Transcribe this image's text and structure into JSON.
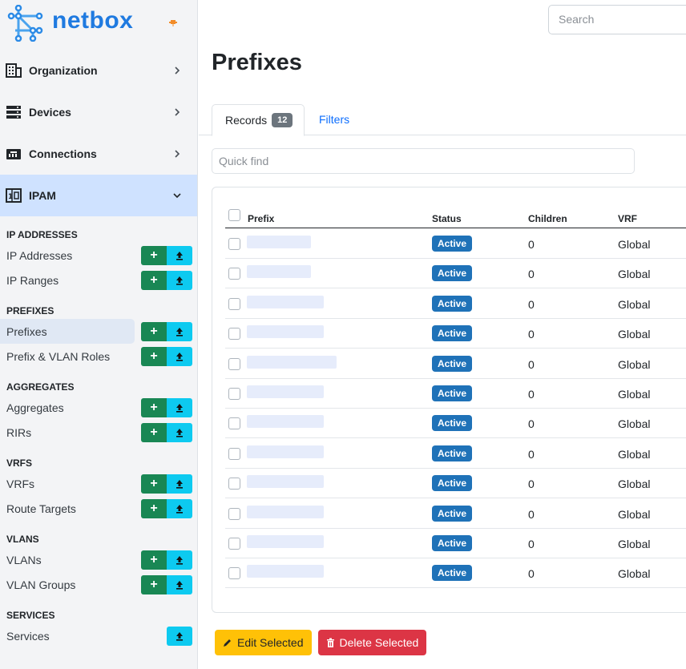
{
  "brand": {
    "name": "netbox"
  },
  "nav": [
    {
      "label": "Organization",
      "icon": "building-icon"
    },
    {
      "label": "Devices",
      "icon": "server-icon"
    },
    {
      "label": "Connections",
      "icon": "ethernet-icon"
    },
    {
      "label": "IPAM",
      "icon": "ipam-icon"
    }
  ],
  "ipam_menu": {
    "ip_addresses_head": "IP ADDRESSES",
    "ip_addresses": "IP Addresses",
    "ip_ranges": "IP Ranges",
    "prefixes_head": "PREFIXES",
    "prefixes": "Prefixes",
    "prefix_vlan_roles": "Prefix & VLAN Roles",
    "aggregates_head": "AGGREGATES",
    "aggregates": "Aggregates",
    "rirs": "RIRs",
    "vrfs_head": "VRFS",
    "vrfs": "VRFs",
    "route_targets": "Route Targets",
    "vlans_head": "VLANS",
    "vlans": "VLANs",
    "vlan_groups": "VLAN Groups",
    "services_head": "SERVICES",
    "services": "Services"
  },
  "search": {
    "placeholder": "Search"
  },
  "page": {
    "title": "Prefixes",
    "tab_records": "Records",
    "records_count": "12",
    "tab_filters": "Filters",
    "quickfind_placeholder": "Quick find"
  },
  "table": {
    "columns": [
      "Prefix",
      "Status",
      "Children",
      "VRF"
    ],
    "rows": [
      {
        "status": "Active",
        "children": "0",
        "vrf": "Global"
      },
      {
        "status": "Active",
        "children": "0",
        "vrf": "Global"
      },
      {
        "status": "Active",
        "children": "0",
        "vrf": "Global"
      },
      {
        "status": "Active",
        "children": "0",
        "vrf": "Global"
      },
      {
        "status": "Active",
        "children": "0",
        "vrf": "Global"
      },
      {
        "status": "Active",
        "children": "0",
        "vrf": "Global"
      },
      {
        "status": "Active",
        "children": "0",
        "vrf": "Global"
      },
      {
        "status": "Active",
        "children": "0",
        "vrf": "Global"
      },
      {
        "status": "Active",
        "children": "0",
        "vrf": "Global"
      },
      {
        "status": "Active",
        "children": "0",
        "vrf": "Global"
      },
      {
        "status": "Active",
        "children": "0",
        "vrf": "Global"
      },
      {
        "status": "Active",
        "children": "0",
        "vrf": "Global"
      }
    ]
  },
  "actions": {
    "edit": "Edit Selected",
    "delete": "Delete Selected"
  },
  "colors": {
    "brand": "#1f7ae0",
    "add": "#198754",
    "import": "#0dcaf0",
    "status_active": "#1f72b8",
    "edit": "#ffc107",
    "delete": "#dc3545"
  }
}
